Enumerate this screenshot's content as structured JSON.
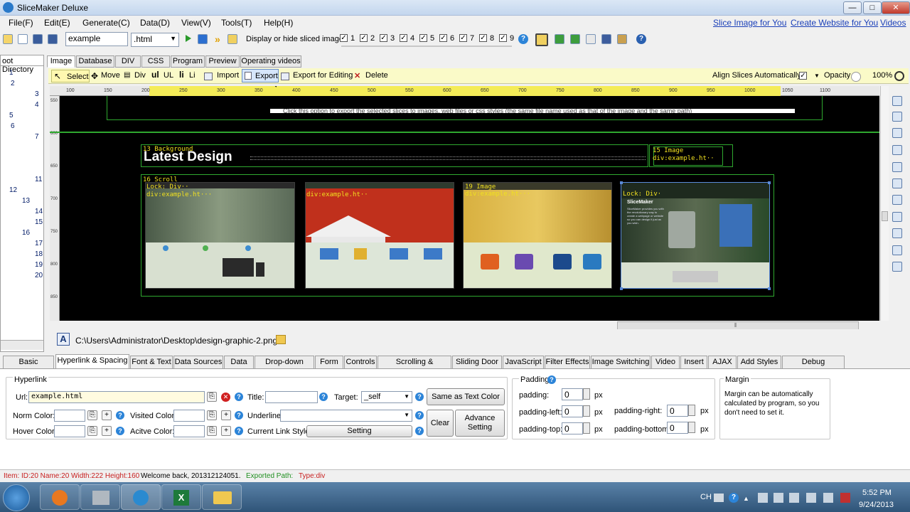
{
  "window": {
    "title": "SliceMaker Deluxe",
    "minimize": "—",
    "maximize": "□",
    "close": "✕"
  },
  "menu": [
    "File(F)",
    "Edit(E)",
    "Generate(C)",
    "Data(D)",
    "View(V)",
    "Tools(T)",
    "Help(H)"
  ],
  "links": [
    "Slice Image for You",
    "Create Website for You",
    "Videos"
  ],
  "toolbar": {
    "filename": "example",
    "extension": ".html",
    "display_label": "Display or hide sliced image:",
    "checks": [
      "1",
      "2",
      "3",
      "4",
      "5",
      "6",
      "7",
      "8",
      "9"
    ]
  },
  "tree": {
    "header": "oot Directory",
    "nodes": [
      "1",
      "2",
      "3",
      "4",
      "5",
      "6",
      "7",
      "11",
      "12",
      "13",
      "14",
      "15",
      "16",
      "17",
      "18",
      "19",
      "20"
    ]
  },
  "tabs": [
    "Image",
    "Database",
    "DIV",
    "CSS",
    "Program",
    "Preview",
    "Operating videos"
  ],
  "toolbar2": {
    "select": "Select",
    "move": "Move",
    "div": "Div",
    "ul": "UL",
    "li": "Li",
    "import": "Import",
    "export": "Export",
    "export_edit": "Export for Editing",
    "delete": "Delete",
    "align": "Align Slices Automatically",
    "opacity": "Opacity",
    "opacity_value": "100%"
  },
  "canvas": {
    "ruler_ticks": [
      "100",
      "150",
      "200",
      "250",
      "300",
      "350",
      "400",
      "450",
      "500",
      "550",
      "600",
      "650",
      "700",
      "750",
      "800",
      "850",
      "900",
      "950",
      "1000",
      "1050",
      "1100"
    ],
    "vruler_ticks": [
      "550",
      "600",
      "650",
      "700",
      "750",
      "800",
      "850"
    ],
    "banner_text": "Click this option to export the selected slices to images, web files or css styles (the same file name used as that of the image and the same path)",
    "heading": "Latest Design",
    "slice13": "13 Background",
    "slice15": "15 Image",
    "slice15b": "div:example.ht··",
    "slice16": "16 Scroll",
    "slice16b": "div:example.ht···",
    "slice17": "Lock: Div··",
    "slice18": "div:example.ht··",
    "slice19": "19 Image",
    "slice19b": "div:example.ht···",
    "slice20": "Lock: Div·",
    "thumb4_title": "SliceMaker",
    "thumb4_text": "SliceMaker provides you with the revolutionary way to create a webpage or website so you can design it just as you wish."
  },
  "path": "C:\\Users\\Administrator\\Desktop\\design-graphic-2.png",
  "panel_tabs": [
    "Basic Attribute",
    "Hyperlink & Spacing",
    "Font & Text",
    "Data Sources",
    "Data",
    "Drop-down Menu",
    "Form",
    "Controls",
    "Scrolling & Movement",
    "Sliding Door",
    "JavaScript",
    "Filter Effects",
    "Image Switching",
    "Video",
    "Insert",
    "AJAX",
    "Add Styles",
    "Debug Information"
  ],
  "hyperlink": {
    "group": "Hyperlink",
    "url_label": "Url:",
    "url_value": "example.html",
    "title_label": "Title:",
    "target_label": "Target:",
    "target_value": "_self",
    "same_btn": "Same as Text Color",
    "norm_color": "Norm Color:",
    "visited_color": "Visited Color:",
    "underline": "Underline:",
    "hover_color": "Hover Color:",
    "active_color": "Acitve Color:",
    "current_style": "Current Link Style:",
    "setting_btn": "Setting",
    "clear_btn": "Clear",
    "advance_btn": "Advance Setting"
  },
  "padding": {
    "group": "Padding",
    "padding": "padding:",
    "padding_left": "padding-left:",
    "padding_right": "padding-right:",
    "padding_top": "padding-top:",
    "padding_bottom": "padding-bottom:",
    "value": "0",
    "unit": "px"
  },
  "margin": {
    "group": "Margin",
    "text": "Margin can be automatically calculated by program, so you don't need to set it."
  },
  "status": {
    "item": "Item: ID:20 Name:20 Width:222 Height:160",
    "welcome": "Welcome back, 201312124051.",
    "exported": "Exported Path:",
    "type": "Type:div"
  },
  "taskbar": {
    "lang": "CH",
    "time": "5:52 PM",
    "date": "9/24/2013"
  },
  "colors": {
    "accent": "#2fa82f",
    "status_red": "#c82020",
    "status_green": "#1f8f1f",
    "slice_label": "#f0e020"
  }
}
